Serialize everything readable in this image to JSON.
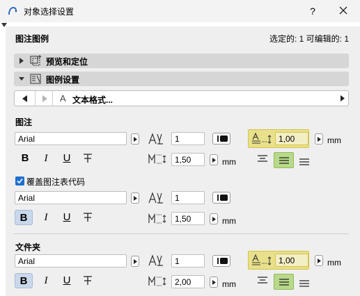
{
  "window": {
    "title": "对象选择设置",
    "help_label": "?"
  },
  "panel": {
    "title": "图注图例",
    "status": "选定的: 1 可编辑的: 1"
  },
  "sections": [
    {
      "label": "预览和定位",
      "expanded": false,
      "icon": "preview-position-icon"
    },
    {
      "label": "图例设置",
      "expanded": true,
      "icon": "legend-settings-icon"
    }
  ],
  "nav": {
    "page_label": "文本格式...",
    "icon": "text-format-icon"
  },
  "groups": [
    {
      "heading": "图注",
      "font": "Arial",
      "width_factor": "1",
      "line_spacing": "1,50",
      "line_spacing_unit": "mm",
      "paragraph_spacing": "1,00",
      "paragraph_spacing_unit": "mm",
      "bold_active": false,
      "alignment_active": "center"
    },
    {
      "checkbox_label": "覆盖图注表代码",
      "checked": true,
      "font": "Arial",
      "width_factor": "1",
      "line_spacing": "1,50",
      "line_spacing_unit": "mm",
      "bold_active": true
    },
    {
      "heading": "文件夹",
      "font": "Arial",
      "width_factor": "1",
      "line_spacing": "2,00",
      "line_spacing_unit": "mm",
      "paragraph_spacing": "1,00",
      "paragraph_spacing_unit": "mm",
      "bold_active": true,
      "alignment_active": "center"
    }
  ],
  "style_buttons": {
    "bold": "B",
    "italic": "I",
    "underline": "U",
    "strike": "T"
  },
  "colors": {
    "panel_bg": "#efefef",
    "highlight": "#e8e08a",
    "align_active": "#b8d98a",
    "bold_active": "#c9d8ea",
    "checkbox": "#1f6fce"
  }
}
